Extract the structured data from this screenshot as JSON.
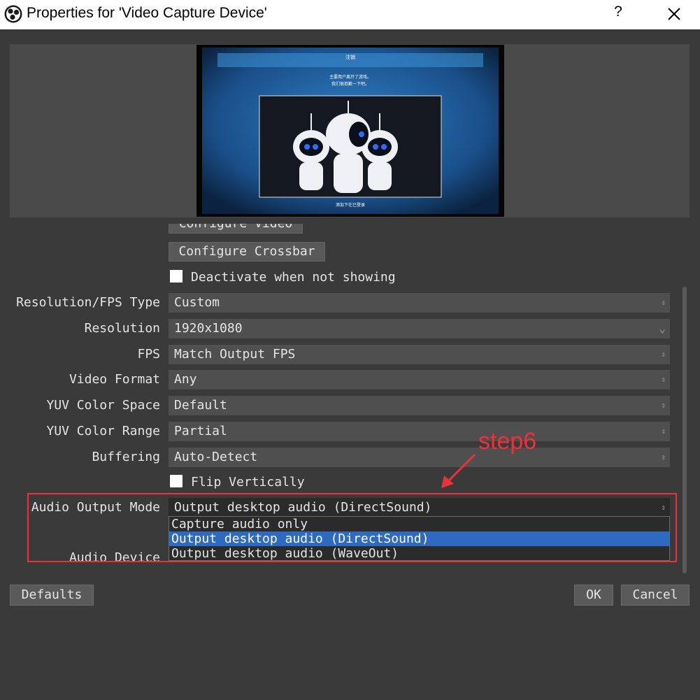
{
  "window": {
    "title": "Properties for 'Video Capture Device'",
    "help_label": "?",
    "icons": {
      "app": "obs-logo-icon",
      "close": "close-icon"
    }
  },
  "preview": {
    "title_cn": "注销",
    "message_cn_line1": "主要用户离开了游戏。",
    "message_cn_line2": "我们很抱歉一下吧。",
    "footer_cn": "添加下在已登录"
  },
  "buttons": {
    "configure_video": "Configure Video",
    "configure_crossbar": "Configure Crossbar",
    "defaults": "Defaults",
    "ok": "OK",
    "cancel": "Cancel"
  },
  "checkboxes": {
    "deactivate": {
      "label": "Deactivate when not showing",
      "checked": false
    },
    "flip": {
      "label": "Flip Vertically",
      "checked": false
    }
  },
  "settings": [
    {
      "label": "Resolution/FPS Type",
      "value": "Custom",
      "arrow": "updown"
    },
    {
      "label": "Resolution",
      "value": "1920x1080",
      "arrow": "down"
    },
    {
      "label": "FPS",
      "value": "Match Output FPS",
      "arrow": "updown"
    },
    {
      "label": "Video Format",
      "value": "Any",
      "arrow": "updown"
    },
    {
      "label": "YUV Color Space",
      "value": "Default",
      "arrow": "updown"
    },
    {
      "label": "YUV Color Range",
      "value": "Partial",
      "arrow": "updown"
    },
    {
      "label": "Buffering",
      "value": "Auto-Detect",
      "arrow": "updown"
    }
  ],
  "audio_output": {
    "label": "Audio Output Mode",
    "value": "Output desktop audio (DirectSound)",
    "options": [
      "Capture audio only",
      "Output desktop audio (DirectSound)",
      "Output desktop audio (WaveOut)"
    ],
    "selected_index": 1
  },
  "audio_device": {
    "label": "Audio Device"
  },
  "annotation": {
    "text": "step6",
    "color": "#e8333a"
  },
  "colors": {
    "accent": "#2d6ac0",
    "background": "#3a3a3a",
    "control": "#4f4f4f",
    "highlight_box": "#e8333a"
  }
}
